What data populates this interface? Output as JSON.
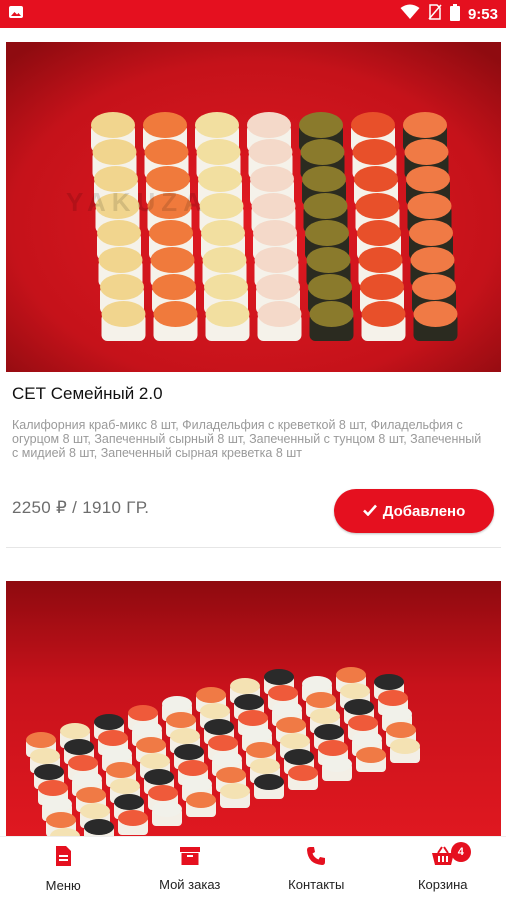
{
  "status_bar": {
    "time": "9:53",
    "icons": [
      "image-icon",
      "wifi-icon",
      "no-sim-icon",
      "battery-icon"
    ]
  },
  "products": [
    {
      "title": "СЕТ Семейный 2.0",
      "description": "Калифорния краб-микс 8 шт, Филадельфия с креветкой 8 шт, Филадельфия с огурцом 8 шт, Запеченный сырный 8 шт, Запеченный с тунцом 8 шт, Запеченный с мидией 8 шт, Запеченный сырная креветка 8 шт",
      "price": "2250 ₽ / 1910 ГР.",
      "button_label": "Добавлено",
      "button_icon": "check-icon",
      "watermark": "YAKUZA"
    },
    {
      "title": "",
      "watermark": ""
    }
  ],
  "bottom_nav": [
    {
      "label": "Меню",
      "icon": "menu-document-icon"
    },
    {
      "label": "Мой заказ",
      "icon": "order-box-icon"
    },
    {
      "label": "Контакты",
      "icon": "phone-icon"
    },
    {
      "label": "Корзина",
      "icon": "basket-icon",
      "badge": "4"
    }
  ],
  "colors": {
    "accent": "#e5101f",
    "photo_background": "#c5121a",
    "price_text": "#6d6d6d",
    "description_text": "#9a9a9a"
  }
}
